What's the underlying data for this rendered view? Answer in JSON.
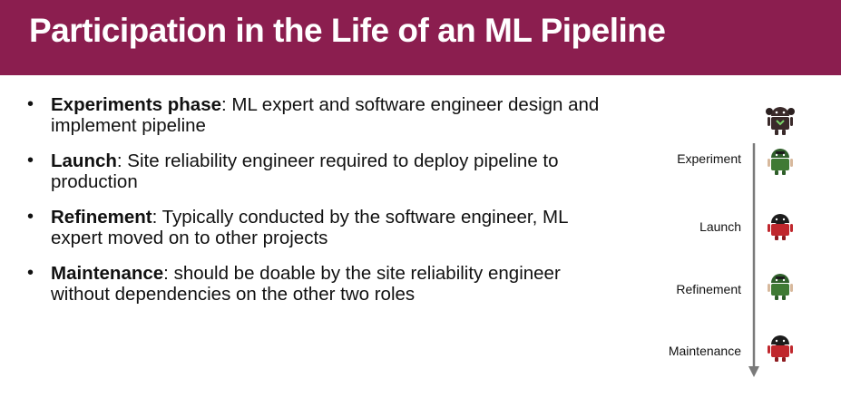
{
  "slide": {
    "title": "Participation in the Life of an ML Pipeline",
    "accent_color": "#8b1e4f"
  },
  "bullets": [
    {
      "term": "Experiments phase",
      "text": ": ML expert and software engineer design and implement pipeline"
    },
    {
      "term": "Launch",
      "text": ": Site reliability engineer required to deploy pipeline to production"
    },
    {
      "term": "Refinement",
      "text": ": Typically conducted by the software engineer, ML expert moved on to other projects"
    },
    {
      "term": "Maintenance",
      "text": ": should be doable by the site reliability engineer without dependencies on the other two roles"
    }
  ],
  "timeline": {
    "stages": [
      {
        "label": "Experiment",
        "avatar": "green-engineer-icon",
        "color": "#3f7a34"
      },
      {
        "label": "Launch",
        "avatar": "red-engineer-icon",
        "color": "#c0272d"
      },
      {
        "label": "Refinement",
        "avatar": "green-engineer-icon",
        "color": "#3f7a34"
      },
      {
        "label": "Maintenance",
        "avatar": "red-engineer-icon",
        "color": "#c0272d"
      }
    ],
    "top_avatar": {
      "avatar": "dark-ml-expert-icon",
      "color": "#3a2a2a"
    }
  }
}
